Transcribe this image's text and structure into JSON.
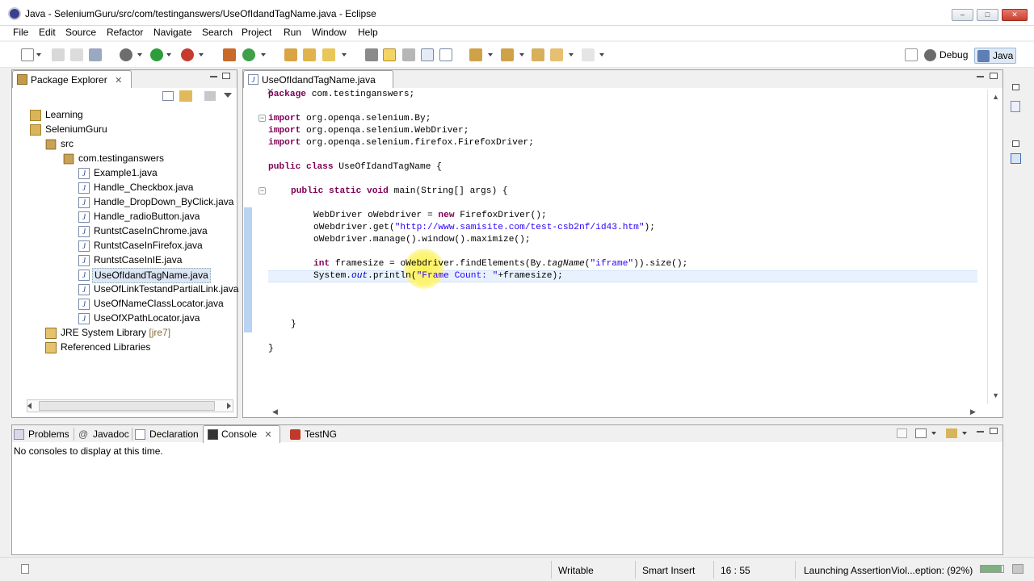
{
  "window": {
    "title": "Java - SeleniumGuru/src/com/testinganswers/UseOfIdandTagName.java - Eclipse",
    "minimize": "–",
    "maximize": "□",
    "close": "✕"
  },
  "menu": [
    "File",
    "Edit",
    "Source",
    "Refactor",
    "Navigate",
    "Search",
    "Project",
    "Run",
    "Window",
    "Help"
  ],
  "perspectives": {
    "debug": "Debug",
    "java": "Java"
  },
  "package_explorer": {
    "tab_label": "Package Explorer",
    "nodes": [
      {
        "label": "Learning",
        "type": "project"
      },
      {
        "label": "SeleniumGuru",
        "type": "project"
      },
      {
        "label": "src",
        "type": "src"
      },
      {
        "label": "com.testinganswers",
        "type": "package"
      },
      {
        "label": "Example1.java",
        "type": "file"
      },
      {
        "label": "Handle_Checkbox.java",
        "type": "file"
      },
      {
        "label": "Handle_DropDown_ByClick.java",
        "type": "file"
      },
      {
        "label": "Handle_radioButton.java",
        "type": "file"
      },
      {
        "label": "RuntstCaseInChrome.java",
        "type": "file"
      },
      {
        "label": "RuntstCaseInFirefox.java",
        "type": "file"
      },
      {
        "label": "RuntstCaseInIE.java",
        "type": "file"
      },
      {
        "label": "UseOfIdandTagName.java",
        "type": "file",
        "selected": true
      },
      {
        "label": "UseOfLinkTestandPartialLink.java",
        "type": "file"
      },
      {
        "label": "UseOfNameClassLocator.java",
        "type": "file"
      },
      {
        "label": "UseOfXPathLocator.java",
        "type": "file"
      },
      {
        "label": "JRE System Library",
        "suffix": "[jre7]",
        "type": "library"
      },
      {
        "label": "Referenced Libraries",
        "type": "library"
      }
    ]
  },
  "editor": {
    "tab_label": "UseOfIdandTagName.java",
    "code": {
      "l1": "package com.testinganswers;",
      "l2": "import org.openqa.selenium.By;",
      "l3": "import org.openqa.selenium.WebDriver;",
      "l4": "import org.openqa.selenium.firefox.FirefoxDriver;",
      "l5": "public class UseOfIdandTagName {",
      "l6": "public static void main(String[] args) {",
      "l7": "WebDriver oWebdriver = new FirefoxDriver();",
      "l8a": "oWebdriver.get(",
      "l8b": "\"http://www.samisite.com/test-csb2nf/id43.htm\"",
      "l8c": ");",
      "l9": "oWebdriver.manage().window().maximize();",
      "l10a": "framesize = oWebdriver.findElements(By.",
      "l10b": "tagName",
      "l10c": "(\"iframe\")).size();",
      "l11a": "System.",
      "l11b": "out",
      "l11c": ".println(",
      "l11d": "\"Frame Count: \"",
      "l11e": "+framesize);",
      "l12": "}",
      "l13": "}",
      "kw_package": "package",
      "kw_import": "import",
      "kw_public": "public",
      "kw_class": "class",
      "kw_static": "static",
      "kw_void": "void",
      "kw_new": "new",
      "kw_int": "int"
    }
  },
  "bottom_tabs": {
    "problems": "Problems",
    "javadoc": "Javadoc",
    "declaration": "Declaration",
    "console": "Console",
    "testng": "TestNG"
  },
  "console": {
    "message": "No consoles to display at this time."
  },
  "status": {
    "writable": "Writable",
    "insert_mode": "Smart Insert",
    "position": "16 : 55",
    "progress": "Launching AssertionViol...eption: (92%)",
    "progress_value": 0.92
  },
  "colors": {
    "keyword": "#7f0055",
    "string": "#2a00ff",
    "field": "#0000c0",
    "selection": "#dde6f4",
    "current_line": "#e8f2fe"
  }
}
